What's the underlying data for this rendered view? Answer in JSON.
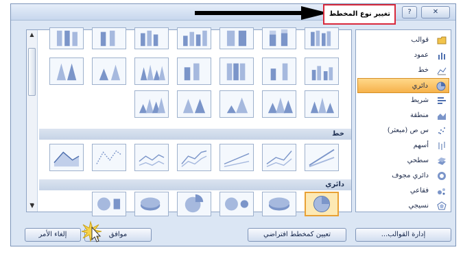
{
  "dialog": {
    "title": "تغيير نوع المخطط",
    "help_glyph": "?",
    "close_glyph": "✕"
  },
  "categories": [
    {
      "label": "قوالب",
      "icon": "folder-icon"
    },
    {
      "label": "عمود",
      "icon": "column-chart-icon"
    },
    {
      "label": "خط",
      "icon": "line-chart-icon"
    },
    {
      "label": "دائري",
      "icon": "pie-chart-icon",
      "selected": true
    },
    {
      "label": "شريط",
      "icon": "bar-chart-icon"
    },
    {
      "label": "منطقة",
      "icon": "area-chart-icon"
    },
    {
      "label": "س ص (مبعثر)",
      "icon": "scatter-chart-icon"
    },
    {
      "label": "أسهم",
      "icon": "stock-chart-icon"
    },
    {
      "label": "سطحي",
      "icon": "surface-chart-icon"
    },
    {
      "label": "دائري مجوف",
      "icon": "doughnut-chart-icon"
    },
    {
      "label": "فقاعي",
      "icon": "bubble-chart-icon"
    },
    {
      "label": "نسيجي",
      "icon": "radar-chart-icon"
    }
  ],
  "sections": {
    "line": "خط",
    "pie": "دائري"
  },
  "buttons": {
    "manage_templates": "إدارة القوالب...",
    "set_default": "تعيين كمخطط افتراضي",
    "ok": "موافق",
    "cancel": "إلغاء الأمر"
  },
  "colors": {
    "accent": "#f6b24b",
    "highlight_border": "#d8283a"
  }
}
